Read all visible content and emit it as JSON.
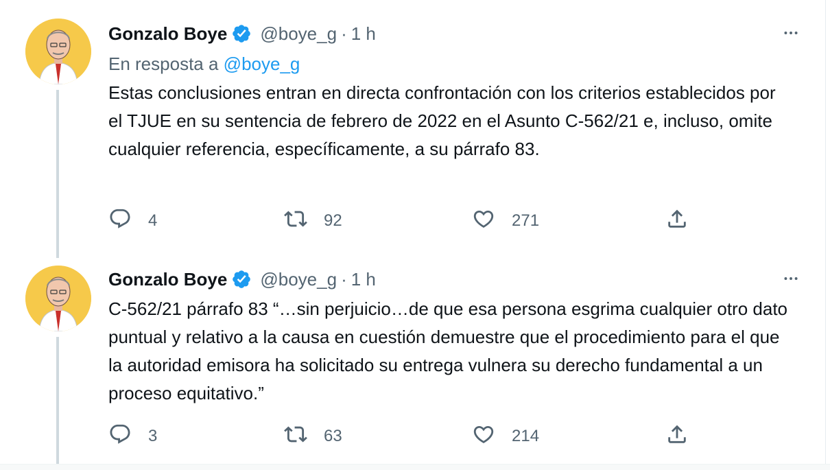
{
  "tweets": [
    {
      "author": {
        "name": "Gonzalo Boye",
        "handle": "@boye_g",
        "time": "1 h"
      },
      "reply_to": {
        "prefix": "En resposta a",
        "mention": "@boye_g"
      },
      "text": "Estas conclusiones entran en directa confrontación con los criterios establecidos por el TJUE en su sentencia de febrero de 2022 en el Asunto C-562/21 e, incluso, omite cualquier referencia, específicamente, a su párrafo 83.",
      "stats": {
        "replies": "4",
        "retweets": "92",
        "likes": "271"
      }
    },
    {
      "author": {
        "name": "Gonzalo Boye",
        "handle": "@boye_g",
        "time": "1 h"
      },
      "text": "C-562/21 párrafo 83 “…sin perjuicio…de que esa persona esgrima cualquier otro dato puntual y relativo a la causa en cuestión demuestre que el procedimiento para el que la autoridad emisora ha solicitado su entrega vulnera su derecho fundamental a un proceso equitativo.”",
      "stats": {
        "replies": "3",
        "retweets": "63",
        "likes": "214"
      }
    }
  ],
  "ui": {
    "separator": "·",
    "icons": [
      "verified-badge-icon",
      "more-icon",
      "reply-icon",
      "retweet-icon",
      "like-icon",
      "share-icon"
    ],
    "colors": {
      "accent": "#1d9bf0",
      "muted": "#536471",
      "text": "#0f1419",
      "avatar_bg": "#f6c94a"
    }
  }
}
